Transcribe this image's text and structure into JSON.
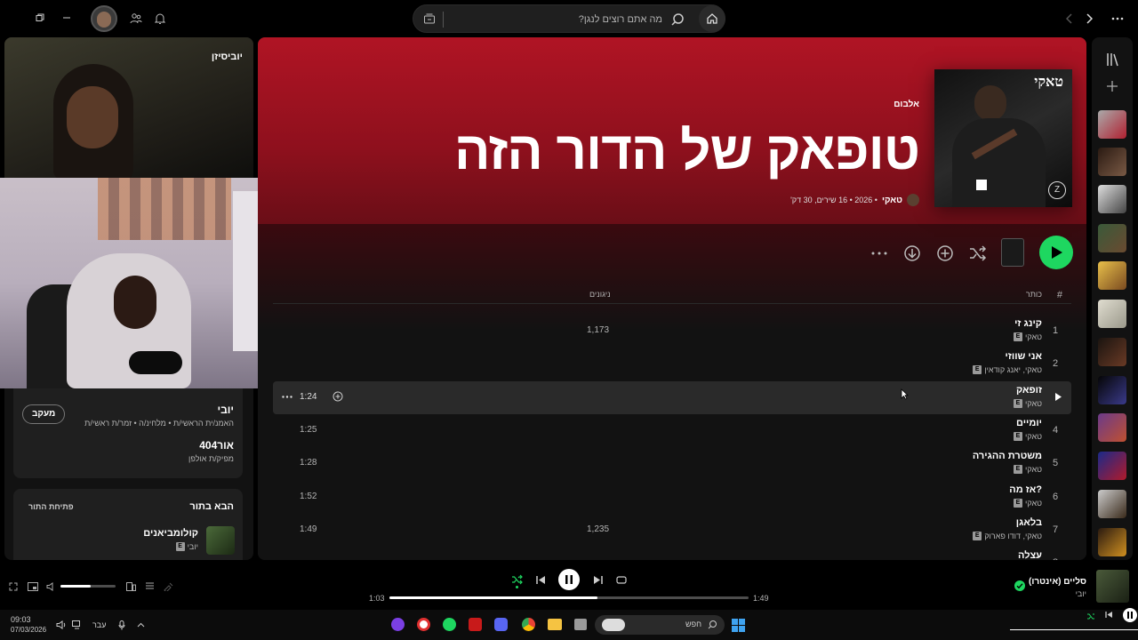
{
  "topbar": {
    "search_placeholder": "מה אתם רוצים לנגן?",
    "window_controls": [
      "restore-icon",
      "minimize-icon"
    ],
    "icons": [
      "friends-icon",
      "bell-icon",
      "more-icon"
    ]
  },
  "album": {
    "type_label": "אלבום",
    "title": "טופאק של הדור הזה",
    "artist": "טאקי",
    "meta": "• 2026 • 16 שירים, 30 דק'",
    "cover_text": "טאקי"
  },
  "tracklist": {
    "col_num": "#",
    "col_title": "כותר",
    "col_plays": "ניגונים",
    "rows": [
      {
        "num": "1",
        "title": "קינג זי",
        "artist": "טאקי",
        "plays": "1,173",
        "dur": ""
      },
      {
        "num": "2",
        "title": "אני שווזי",
        "artist": "טאקי, יאנג קודאין",
        "plays": "",
        "dur": ""
      },
      {
        "num": "3",
        "title": "זופאק",
        "artist": "טאקי",
        "plays": "",
        "dur": "1:24"
      },
      {
        "num": "4",
        "title": "יומיים",
        "artist": "טאקי",
        "plays": "",
        "dur": "1:25"
      },
      {
        "num": "5",
        "title": "משטרת ההגירה",
        "artist": "טאקי",
        "plays": "",
        "dur": "1:28"
      },
      {
        "num": "6",
        "title": "אז מה?",
        "artist": "טאקי",
        "plays": "",
        "dur": "1:52"
      },
      {
        "num": "7",
        "title": "בלאגן",
        "artist": "טאקי, דודו פארוק",
        "plays": "1,235",
        "dur": "1:49"
      },
      {
        "num": "8",
        "title": "עצלה",
        "artist": "",
        "plays": "",
        "dur": ""
      }
    ]
  },
  "leftpanel": {
    "now_playing_title": "יוביסיזן",
    "artist_name": "יובי",
    "artist_roles": "האמנ/ית הראשי/ת • מלחינ/ה • זמר/ת ראשי/ת",
    "follow_label": "מעקב",
    "credit_name": "אור404",
    "credit_role": "מפיק/ת אולפן",
    "queue_heading": "הבא בתור",
    "queue_open": "פתיחת התור",
    "queue_track_title": "קולומביאנים",
    "queue_track_artist": "יובי"
  },
  "player": {
    "track_title": "סליים (אינטרו)",
    "track_artist": "יובי",
    "elapsed": "1:03",
    "total": "1:49",
    "progress": 0.58,
    "volume": 0.55,
    "accent": "#1ed760"
  },
  "taskbar": {
    "time": "09:03",
    "date": "07/03/2026",
    "lang": "עבר",
    "search_label": "חפש"
  }
}
